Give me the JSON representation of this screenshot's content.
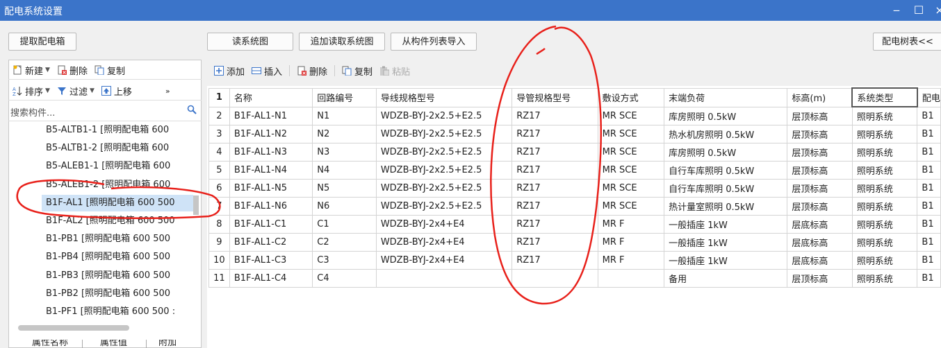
{
  "window": {
    "title": "配电系统设置",
    "minimize": "‒",
    "maximize": "☐",
    "close": "×"
  },
  "left": {
    "extract_button": "提取配电箱",
    "toolbar1": {
      "new": "新建",
      "delete": "删除",
      "copy": "复制"
    },
    "toolbar2": {
      "sort": "排序",
      "filter": "过滤",
      "move_up": "上移",
      "more": "»"
    },
    "search_placeholder": "搜索构件...",
    "items": [
      "B5-ALTB1-1 [照明配电箱 600",
      "B5-ALTB1-2 [照明配电箱 600",
      "B5-ALEB1-1 [照明配电箱 600",
      "B5-ALEB1-2 [照明配电箱 600",
      "B1F-AL1 [照明配电箱 600 500",
      "B1F-AL2 [照明配电箱 600 500",
      "B1-PB1 [照明配电箱 600 500",
      "B1-PB4 [照明配电箱 600 500",
      "B1-PB3 [照明配电箱 600 500",
      "B1-PB2 [照明配电箱 600 500",
      "B1-PF1 [照明配电箱 600 500 :"
    ],
    "selected_index": 4,
    "bottom_tabs": [
      "属性名称",
      "属性值",
      "附加"
    ]
  },
  "top_buttons": {
    "read": "读系统图",
    "append": "追加读取系统图",
    "import": "从构件列表导入",
    "tree": "配电树表<<"
  },
  "table_toolbar": {
    "add": "添加",
    "insert": "插入",
    "delete": "删除",
    "copy": "复制",
    "paste": "粘贴"
  },
  "table": {
    "header_num": "1",
    "columns": [
      "名称",
      "回路编号",
      "导线规格型号",
      "导管规格型号",
      "敷设方式",
      "末端负荷",
      "标高(m)",
      "系统类型",
      "配电"
    ],
    "rows": [
      {
        "n": "2",
        "c": [
          "B1F-AL1-N1",
          "N1",
          "WDZB-BYJ-2x2.5+E2.5",
          "RZ17",
          "MR SCE",
          "库房照明 0.5kW",
          "层顶标高",
          "照明系统",
          "B1"
        ]
      },
      {
        "n": "3",
        "c": [
          "B1F-AL1-N2",
          "N2",
          "WDZB-BYJ-2x2.5+E2.5",
          "RZ17",
          "MR SCE",
          "热水机房照明 0.5kW",
          "层顶标高",
          "照明系统",
          "B1"
        ]
      },
      {
        "n": "4",
        "c": [
          "B1F-AL1-N3",
          "N3",
          "WDZB-BYJ-2x2.5+E2.5",
          "RZ17",
          "MR SCE",
          "库房照明 0.5kW",
          "层顶标高",
          "照明系统",
          "B1"
        ]
      },
      {
        "n": "5",
        "c": [
          "B1F-AL1-N4",
          "N4",
          "WDZB-BYJ-2x2.5+E2.5",
          "RZ17",
          "MR SCE",
          "自行车库照明 0.5kW",
          "层顶标高",
          "照明系统",
          "B1"
        ]
      },
      {
        "n": "6",
        "c": [
          "B1F-AL1-N5",
          "N5",
          "WDZB-BYJ-2x2.5+E2.5",
          "RZ17",
          "MR SCE",
          "自行车库照明 0.5kW",
          "层顶标高",
          "照明系统",
          "B1"
        ]
      },
      {
        "n": "7",
        "c": [
          "B1F-AL1-N6",
          "N6",
          "WDZB-BYJ-2x2.5+E2.5",
          "RZ17",
          "MR SCE",
          "热计量室照明 0.5kW",
          "层顶标高",
          "照明系统",
          "B1"
        ]
      },
      {
        "n": "8",
        "c": [
          "B1F-AL1-C1",
          "C1",
          "WDZB-BYJ-2x4+E4",
          "RZ17",
          "MR F",
          "一般插座 1kW",
          "层底标高",
          "照明系统",
          "B1"
        ]
      },
      {
        "n": "9",
        "c": [
          "B1F-AL1-C2",
          "C2",
          "WDZB-BYJ-2x4+E4",
          "RZ17",
          "MR F",
          "一般插座 1kW",
          "层底标高",
          "照明系统",
          "B1"
        ]
      },
      {
        "n": "10",
        "c": [
          "B1F-AL1-C3",
          "C3",
          "WDZB-BYJ-2x4+E4",
          "RZ17",
          "MR F",
          "一般插座 1kW",
          "层底标高",
          "照明系统",
          "B1"
        ]
      },
      {
        "n": "11",
        "c": [
          "B1F-AL1-C4",
          "C4",
          "",
          "",
          "",
          "备用",
          "层顶标高",
          "照明系统",
          "B1"
        ]
      }
    ]
  },
  "colors": {
    "titlebar": "#3b74c9",
    "annotation": "#e8201a",
    "selection": "#cfe3f7"
  }
}
